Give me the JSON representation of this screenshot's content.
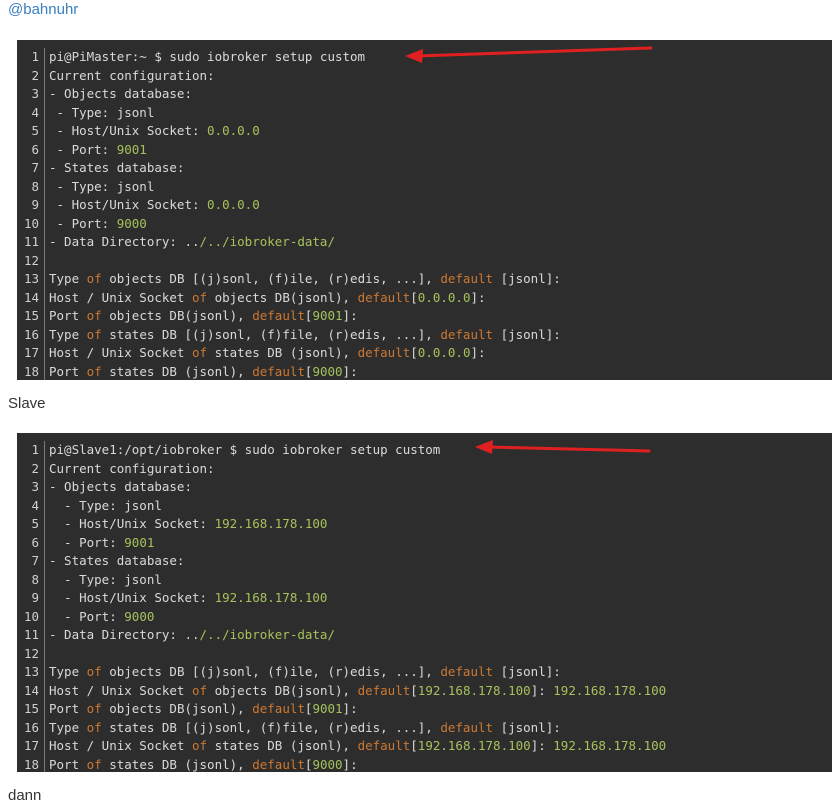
{
  "mention": "@bahnuhr",
  "colors": {
    "code_bg": "#2d2d2d",
    "keyword": "#cc7832",
    "string": "#a5c25c",
    "plain": "#d9d9d9",
    "arrow": "#e02020",
    "link": "#3a7fc1"
  },
  "master_block": {
    "lines": [
      {
        "n": "1",
        "parts": [
          {
            "t": "plain",
            "v": "pi@PiMaster:~ $ sudo iobroker setup custom"
          }
        ]
      },
      {
        "n": "2",
        "parts": [
          {
            "t": "plain",
            "v": "Current configuration:"
          }
        ]
      },
      {
        "n": "3",
        "parts": [
          {
            "t": "plain",
            "v": "- Objects database:"
          }
        ]
      },
      {
        "n": "4",
        "parts": [
          {
            "t": "plain",
            "v": " - Type: jsonl"
          }
        ]
      },
      {
        "n": "5",
        "parts": [
          {
            "t": "plain",
            "v": " - Host/Unix Socket: "
          },
          {
            "t": "num",
            "v": "0.0.0.0"
          }
        ]
      },
      {
        "n": "6",
        "parts": [
          {
            "t": "plain",
            "v": " - Port: "
          },
          {
            "t": "num",
            "v": "9001"
          }
        ]
      },
      {
        "n": "7",
        "parts": [
          {
            "t": "plain",
            "v": "- States database:"
          }
        ]
      },
      {
        "n": "8",
        "parts": [
          {
            "t": "plain",
            "v": " - Type: jsonl"
          }
        ]
      },
      {
        "n": "9",
        "parts": [
          {
            "t": "plain",
            "v": " - Host/Unix Socket: "
          },
          {
            "t": "num",
            "v": "0.0.0.0"
          }
        ]
      },
      {
        "n": "10",
        "parts": [
          {
            "t": "plain",
            "v": " - Port: "
          },
          {
            "t": "num",
            "v": "9000"
          }
        ]
      },
      {
        "n": "11",
        "parts": [
          {
            "t": "plain",
            "v": "- Data Directory: .."
          },
          {
            "t": "str",
            "v": "/../iobroker-data/"
          }
        ]
      },
      {
        "n": "12",
        "parts": []
      },
      {
        "n": "13",
        "parts": [
          {
            "t": "plain",
            "v": "Type "
          },
          {
            "t": "kw",
            "v": "of"
          },
          {
            "t": "plain",
            "v": " objects DB [(j)sonl, (f)ile, (r)edis, ...], "
          },
          {
            "t": "kw",
            "v": "default"
          },
          {
            "t": "plain",
            "v": " [jsonl]:"
          }
        ]
      },
      {
        "n": "14",
        "parts": [
          {
            "t": "plain",
            "v": "Host / Unix Socket "
          },
          {
            "t": "kw",
            "v": "of"
          },
          {
            "t": "plain",
            "v": " objects DB(jsonl), "
          },
          {
            "t": "kw",
            "v": "default"
          },
          {
            "t": "plain",
            "v": "["
          },
          {
            "t": "num",
            "v": "0.0.0.0"
          },
          {
            "t": "plain",
            "v": "]:"
          }
        ]
      },
      {
        "n": "15",
        "parts": [
          {
            "t": "plain",
            "v": "Port "
          },
          {
            "t": "kw",
            "v": "of"
          },
          {
            "t": "plain",
            "v": " objects DB(jsonl), "
          },
          {
            "t": "kw",
            "v": "default"
          },
          {
            "t": "plain",
            "v": "["
          },
          {
            "t": "num",
            "v": "9001"
          },
          {
            "t": "plain",
            "v": "]:"
          }
        ]
      },
      {
        "n": "16",
        "parts": [
          {
            "t": "plain",
            "v": "Type "
          },
          {
            "t": "kw",
            "v": "of"
          },
          {
            "t": "plain",
            "v": " states DB [(j)sonl, (f)file, (r)edis, ...], "
          },
          {
            "t": "kw",
            "v": "default"
          },
          {
            "t": "plain",
            "v": " [jsonl]:"
          }
        ]
      },
      {
        "n": "17",
        "parts": [
          {
            "t": "plain",
            "v": "Host / Unix Socket "
          },
          {
            "t": "kw",
            "v": "of"
          },
          {
            "t": "plain",
            "v": " states DB (jsonl), "
          },
          {
            "t": "kw",
            "v": "default"
          },
          {
            "t": "plain",
            "v": "["
          },
          {
            "t": "num",
            "v": "0.0.0.0"
          },
          {
            "t": "plain",
            "v": "]:"
          }
        ]
      },
      {
        "n": "18",
        "parts": [
          {
            "t": "plain",
            "v": "Port "
          },
          {
            "t": "kw",
            "v": "of"
          },
          {
            "t": "plain",
            "v": " states DB (jsonl), "
          },
          {
            "t": "kw",
            "v": "default"
          },
          {
            "t": "plain",
            "v": "["
          },
          {
            "t": "num",
            "v": "9000"
          },
          {
            "t": "plain",
            "v": "]:"
          }
        ]
      }
    ]
  },
  "slave_label": "Slave",
  "slave_block": {
    "lines": [
      {
        "n": "1",
        "parts": [
          {
            "t": "plain",
            "v": "pi@Slave1:/opt/iobroker $ sudo iobroker setup custom"
          }
        ]
      },
      {
        "n": "2",
        "parts": [
          {
            "t": "plain",
            "v": "Current configuration:"
          }
        ]
      },
      {
        "n": "3",
        "parts": [
          {
            "t": "plain",
            "v": "- Objects database:"
          }
        ]
      },
      {
        "n": "4",
        "parts": [
          {
            "t": "plain",
            "v": "  - Type: jsonl"
          }
        ]
      },
      {
        "n": "5",
        "parts": [
          {
            "t": "plain",
            "v": "  - Host/Unix Socket: "
          },
          {
            "t": "num",
            "v": "192.168.178.100"
          }
        ]
      },
      {
        "n": "6",
        "parts": [
          {
            "t": "plain",
            "v": "  - Port: "
          },
          {
            "t": "num",
            "v": "9001"
          }
        ]
      },
      {
        "n": "7",
        "parts": [
          {
            "t": "plain",
            "v": "- States database:"
          }
        ]
      },
      {
        "n": "8",
        "parts": [
          {
            "t": "plain",
            "v": "  - Type: jsonl"
          }
        ]
      },
      {
        "n": "9",
        "parts": [
          {
            "t": "plain",
            "v": "  - Host/Unix Socket: "
          },
          {
            "t": "num",
            "v": "192.168.178.100"
          }
        ]
      },
      {
        "n": "10",
        "parts": [
          {
            "t": "plain",
            "v": "  - Port: "
          },
          {
            "t": "num",
            "v": "9000"
          }
        ]
      },
      {
        "n": "11",
        "parts": [
          {
            "t": "plain",
            "v": "- Data Directory: .."
          },
          {
            "t": "str",
            "v": "/../iobroker-data/"
          }
        ]
      },
      {
        "n": "12",
        "parts": []
      },
      {
        "n": "13",
        "parts": [
          {
            "t": "plain",
            "v": "Type "
          },
          {
            "t": "kw",
            "v": "of"
          },
          {
            "t": "plain",
            "v": " objects DB [(j)sonl, (f)ile, (r)edis, ...], "
          },
          {
            "t": "kw",
            "v": "default"
          },
          {
            "t": "plain",
            "v": " [jsonl]:"
          }
        ]
      },
      {
        "n": "14",
        "parts": [
          {
            "t": "plain",
            "v": "Host / Unix Socket "
          },
          {
            "t": "kw",
            "v": "of"
          },
          {
            "t": "plain",
            "v": " objects DB(jsonl), "
          },
          {
            "t": "kw",
            "v": "default"
          },
          {
            "t": "plain",
            "v": "["
          },
          {
            "t": "num",
            "v": "192.168.178.100"
          },
          {
            "t": "plain",
            "v": "]: "
          },
          {
            "t": "num",
            "v": "192.168.178.100"
          }
        ]
      },
      {
        "n": "15",
        "parts": [
          {
            "t": "plain",
            "v": "Port "
          },
          {
            "t": "kw",
            "v": "of"
          },
          {
            "t": "plain",
            "v": " objects DB(jsonl), "
          },
          {
            "t": "kw",
            "v": "default"
          },
          {
            "t": "plain",
            "v": "["
          },
          {
            "t": "num",
            "v": "9001"
          },
          {
            "t": "plain",
            "v": "]:"
          }
        ]
      },
      {
        "n": "16",
        "parts": [
          {
            "t": "plain",
            "v": "Type "
          },
          {
            "t": "kw",
            "v": "of"
          },
          {
            "t": "plain",
            "v": " states DB [(j)sonl, (f)file, (r)edis, ...], "
          },
          {
            "t": "kw",
            "v": "default"
          },
          {
            "t": "plain",
            "v": " [jsonl]:"
          }
        ]
      },
      {
        "n": "17",
        "parts": [
          {
            "t": "plain",
            "v": "Host / Unix Socket "
          },
          {
            "t": "kw",
            "v": "of"
          },
          {
            "t": "plain",
            "v": " states DB (jsonl), "
          },
          {
            "t": "kw",
            "v": "default"
          },
          {
            "t": "plain",
            "v": "["
          },
          {
            "t": "num",
            "v": "192.168.178.100"
          },
          {
            "t": "plain",
            "v": "]: "
          },
          {
            "t": "num",
            "v": "192.168.178.100"
          }
        ]
      },
      {
        "n": "18",
        "parts": [
          {
            "t": "plain",
            "v": "Port "
          },
          {
            "t": "kw",
            "v": "of"
          },
          {
            "t": "plain",
            "v": " states DB (jsonl), "
          },
          {
            "t": "kw",
            "v": "default"
          },
          {
            "t": "plain",
            "v": "["
          },
          {
            "t": "num",
            "v": "9000"
          },
          {
            "t": "plain",
            "v": "]:"
          }
        ]
      }
    ]
  },
  "dann_label": "dann"
}
